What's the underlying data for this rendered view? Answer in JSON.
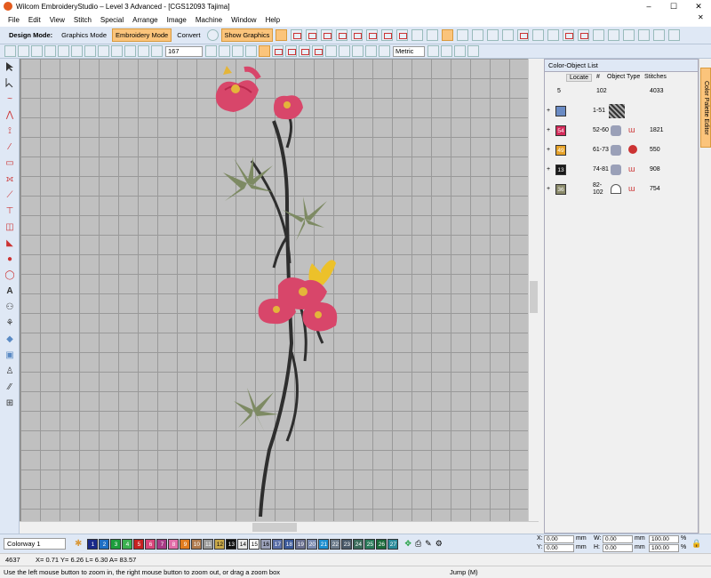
{
  "window": {
    "title": "Wilcom EmbroideryStudio – Level 3 Advanced - [CGS12093       Tajima]",
    "min": "–",
    "max": "☐",
    "close": "✕"
  },
  "menu": [
    "File",
    "Edit",
    "View",
    "Stitch",
    "Special",
    "Arrange",
    "Image",
    "Machine",
    "Window",
    "Help"
  ],
  "modebar": {
    "label": "Design Mode:",
    "graphics": "Graphics Mode",
    "embroidery": "Embroidery Mode",
    "convert": "Convert",
    "show_graphics": "Show Graphics"
  },
  "toolbar2": {
    "zoom": "167",
    "units": "Metric"
  },
  "panel": {
    "title": "Color-Object List",
    "cols": {
      "locate": "Locate",
      "num": "#",
      "type": "Object Type",
      "stitches": "Stitches"
    },
    "summary": {
      "count": "5",
      "objects": "102",
      "stitches": "4033"
    },
    "rows": [
      {
        "color": "",
        "range": "1-51",
        "stitches": "",
        "swatch": "#6a8bc4"
      },
      {
        "color": "54",
        "range": "52-60",
        "stitches": "1821",
        "swatch": "#d42b5a"
      },
      {
        "color": "49",
        "range": "61-73",
        "stitches": "550",
        "swatch": "#e6a228"
      },
      {
        "color": "13",
        "range": "74-81",
        "stitches": "908",
        "swatch": "#1a1a1a"
      },
      {
        "color": "36",
        "range": "82-102",
        "stitches": "754",
        "swatch": "#8a8a6a"
      }
    ]
  },
  "sidetab": {
    "label": "Color Palette Editor"
  },
  "colorbar": {
    "colorway": "Colorway 1",
    "chips": [
      {
        "n": "1",
        "c": "#1a2a8a",
        "t": "#fff"
      },
      {
        "n": "2",
        "c": "#1d6fc4",
        "t": "#fff"
      },
      {
        "n": "3",
        "c": "#1c9e3c",
        "t": "#fff"
      },
      {
        "n": "4",
        "c": "#3cb050",
        "t": "#fff"
      },
      {
        "n": "5",
        "c": "#c72121",
        "t": "#fff"
      },
      {
        "n": "6",
        "c": "#d8457a",
        "t": "#fff"
      },
      {
        "n": "7",
        "c": "#a83b86",
        "t": "#fff"
      },
      {
        "n": "8",
        "c": "#e26da8",
        "t": "#fff"
      },
      {
        "n": "9",
        "c": "#e07c1e",
        "t": "#fff"
      },
      {
        "n": "10",
        "c": "#b07a4e",
        "t": "#fff"
      },
      {
        "n": "11",
        "c": "#9a9a9a",
        "t": "#fff"
      },
      {
        "n": "12",
        "c": "#c8a84a",
        "t": "#000"
      },
      {
        "n": "13",
        "c": "#111111",
        "t": "#fff"
      },
      {
        "n": "14",
        "c": "#e8e8e8",
        "t": "#000"
      },
      {
        "n": "15",
        "c": "#ffffff",
        "t": "#000"
      },
      {
        "n": "16",
        "c": "#9aa0b8",
        "t": "#000"
      },
      {
        "n": "17",
        "c": "#5a6fa8",
        "t": "#fff"
      },
      {
        "n": "18",
        "c": "#3c5a9a",
        "t": "#fff"
      },
      {
        "n": "19",
        "c": "#6a7090",
        "t": "#fff"
      },
      {
        "n": "20",
        "c": "#7a8ab0",
        "t": "#fff"
      },
      {
        "n": "21",
        "c": "#1d8fd0",
        "t": "#fff"
      },
      {
        "n": "22",
        "c": "#6b7a8a",
        "t": "#fff"
      },
      {
        "n": "23",
        "c": "#4a5a6a",
        "t": "#fff"
      },
      {
        "n": "24",
        "c": "#3a6b5a",
        "t": "#fff"
      },
      {
        "n": "25",
        "c": "#2a7a5a",
        "t": "#fff"
      },
      {
        "n": "26",
        "c": "#1a6a3a",
        "t": "#fff"
      },
      {
        "n": "27",
        "c": "#2a8a9a",
        "t": "#fff"
      }
    ]
  },
  "xyz": {
    "x": "0.00",
    "y": "0.00",
    "w": "0.00",
    "h": "0.00",
    "sx": "100.00",
    "sy": "100.00",
    "unit": "mm",
    "pct": "%"
  },
  "status": {
    "count": "4637",
    "coords": "X=   0.71 Y=   6.26 L=   6.30 A= 83.57",
    "hint": "Use the left mouse button to zoom in, the right mouse button to zoom out, or drag a zoom box",
    "jump": "Jump (M)"
  },
  "tool_icons": [
    "select-icon",
    "reshape-icon",
    "travel-icon",
    "stitch-icon",
    "knife-icon",
    "satin-icon",
    "fill-icon",
    "column-icon",
    "lettering-icon",
    "monogram-icon",
    "appliqué-icon",
    "shapes-icon",
    "circle-icon",
    "outline-icon",
    "text-icon",
    "team-names-icon",
    "motif-icon",
    "element-icon",
    "stamp-icon",
    "mirror-icon",
    "array-icon"
  ]
}
